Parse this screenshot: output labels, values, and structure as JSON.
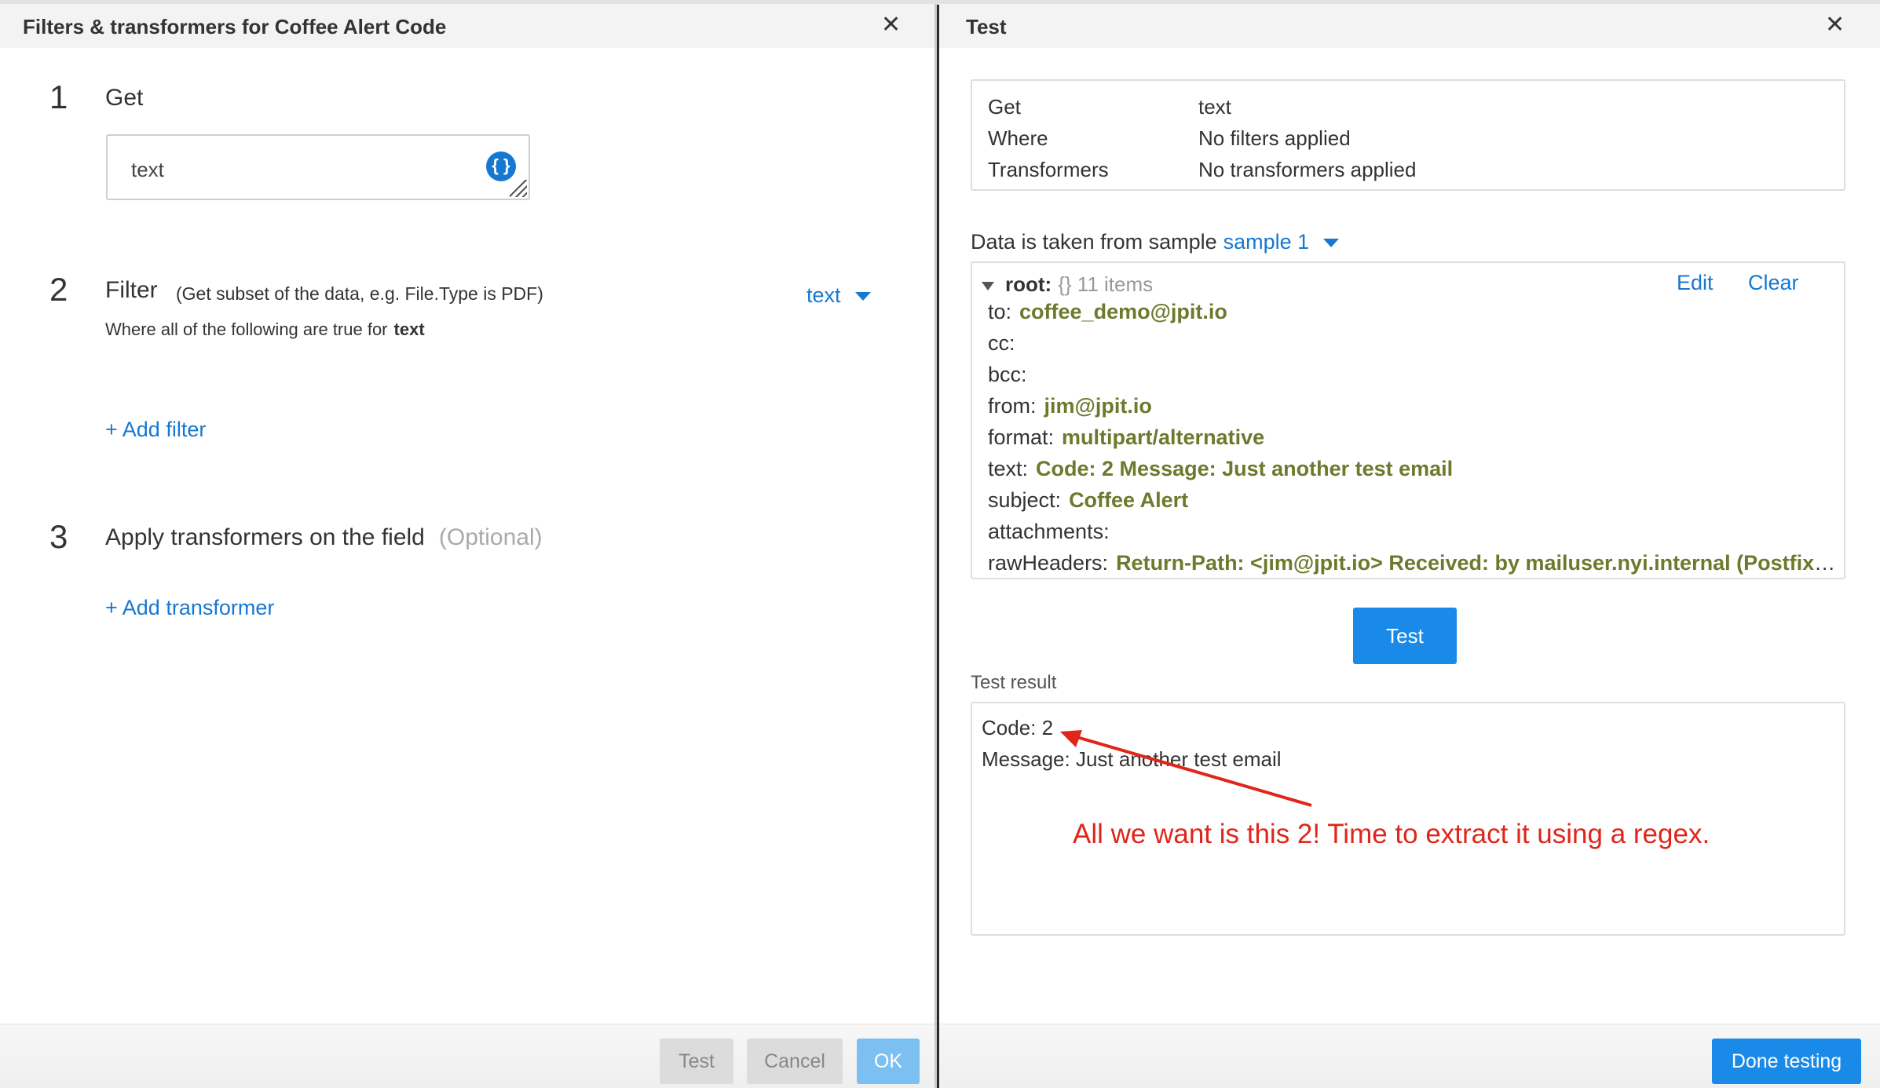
{
  "left_panel": {
    "title": "Filters & transformers for Coffee Alert Code",
    "close_glyph": "✕",
    "step1": {
      "number": "1",
      "title": "Get",
      "field_value": "text",
      "brace_glyph": "{ }"
    },
    "step2": {
      "number": "2",
      "title": "Filter",
      "hint": "(Get subset of the data, e.g. File.Type is PDF)",
      "selector_value": "text",
      "where_prefix": "Where all of the following are true for",
      "where_field": "text",
      "add_filter": "+ Add filter"
    },
    "step3": {
      "number": "3",
      "title": "Apply transformers on the field",
      "optional": "(Optional)",
      "add_transformer": "+ Add transformer"
    },
    "footer": {
      "test": "Test",
      "cancel": "Cancel",
      "ok": "OK"
    }
  },
  "right_panel": {
    "title": "Test",
    "close_glyph": "✕",
    "summary": [
      {
        "label": "Get",
        "value": "text"
      },
      {
        "label": "Where",
        "value": "No filters applied"
      },
      {
        "label": "Transformers",
        "value": "No transformers applied"
      }
    ],
    "sample_prefix": "Data is taken from sample",
    "sample_value": "sample 1",
    "tree": {
      "root_label": "root:",
      "root_meta": "{} 11 items",
      "edit": "Edit",
      "clear": "Clear",
      "rows": [
        {
          "key": "to:",
          "value": "coffee_demo@jpit.io"
        },
        {
          "key": "cc:",
          "value": ""
        },
        {
          "key": "bcc:",
          "value": ""
        },
        {
          "key": "from:",
          "value": "jim@jpit.io"
        },
        {
          "key": "format:",
          "value": "multipart/alternative"
        },
        {
          "key": "text:",
          "value": "Code: 2 Message: Just another test email"
        },
        {
          "key": "subject:",
          "value": "Coffee Alert"
        },
        {
          "key": "attachments:",
          "value": ""
        },
        {
          "key": "rawHeaders:",
          "value": "Return-Path: <jim@jpit.io> Received: by mailuser.nyi.internal (Postfix, fro..."
        }
      ]
    },
    "test_button": "Test",
    "result_label": "Test result",
    "result_lines": [
      "Code: 2",
      "Message: Just another test email"
    ],
    "annotation": "All we want is this 2!  Time to extract it using a regex.",
    "annotation_color": "#e0251a",
    "done_button": "Done testing"
  }
}
